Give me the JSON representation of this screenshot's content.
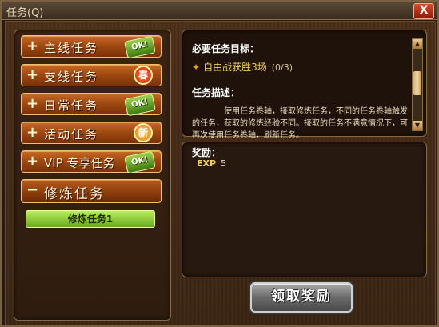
{
  "window": {
    "title": "任务(Q)",
    "close_label": "X"
  },
  "categories": [
    {
      "label": "主线任务",
      "sign": "+",
      "badge": "OK!",
      "badge_type": "ok"
    },
    {
      "label": "支线任务",
      "sign": "+",
      "badge": "春",
      "badge_type": "red"
    },
    {
      "label": "日常任务",
      "sign": "+",
      "badge": "OK!",
      "badge_type": "ok"
    },
    {
      "label": "活动任务",
      "sign": "+",
      "badge": "新",
      "badge_type": "orange"
    },
    {
      "label": "VIP 专享任务",
      "sign": "+",
      "badge": "OK!",
      "badge_type": "ok"
    },
    {
      "label": "修炼任务",
      "sign": "−",
      "badge": "",
      "badge_type": "none"
    }
  ],
  "sub_items": [
    {
      "label": "修炼任务1"
    }
  ],
  "task_info": {
    "goal_heading": "必要任务目标：",
    "goal_text": "自由战获胜3场",
    "goal_progress": "(0/3)",
    "desc_heading": "任务描述：",
    "desc_text": "使用任务卷轴，接取修炼任务，不同的任务卷轴触发的任务，获取的修炼经验不同。接取的任务不满意情况下，可再次使用任务卷轴，刷新任务。"
  },
  "rewards": {
    "heading": "奖励：",
    "items": [
      {
        "label": "EXP",
        "value": "5"
      }
    ]
  },
  "claim_button": {
    "label": "领取奖励"
  },
  "colors": {
    "accent_gold": "#f0d060",
    "button_orange": "#c86a24",
    "selected_green": "#b8f05a"
  }
}
